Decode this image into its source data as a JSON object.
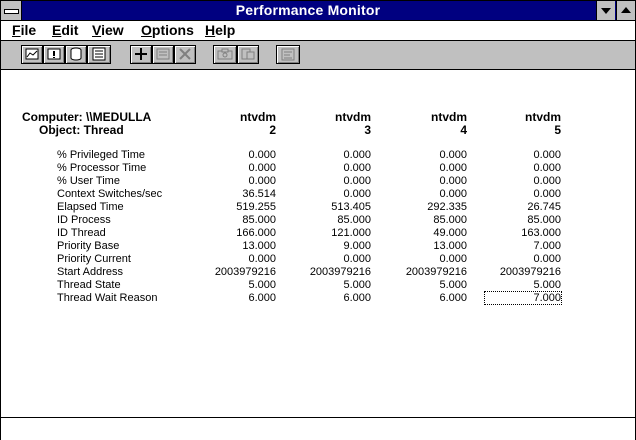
{
  "window": {
    "title": "Performance Monitor"
  },
  "menu": {
    "items": [
      {
        "key": "F",
        "rest": "ile"
      },
      {
        "key": "E",
        "rest": "dit"
      },
      {
        "key": "V",
        "rest": "iew"
      },
      {
        "key": "O",
        "rest": "ptions"
      },
      {
        "key": "H",
        "rest": "elp"
      }
    ]
  },
  "toolbar": {
    "buttons": [
      "chart-view-icon",
      "alert-view-icon",
      "log-view-icon",
      "report-view-icon",
      "add-icon",
      "edit-icon",
      "delete-icon",
      "update-now-icon",
      "bookmark-icon",
      "options-icon"
    ]
  },
  "report": {
    "computer_label": "Computer: \\\\MEDULLA",
    "object_label": "Object: Thread",
    "instances": [
      {
        "name": "ntvdm",
        "id": "2"
      },
      {
        "name": "ntvdm",
        "id": "3"
      },
      {
        "name": "ntvdm",
        "id": "4"
      },
      {
        "name": "ntvdm",
        "id": "5"
      }
    ],
    "counters": [
      {
        "name": "% Privileged Time",
        "values": [
          "0.000",
          "0.000",
          "0.000",
          "0.000"
        ]
      },
      {
        "name": "% Processor Time",
        "values": [
          "0.000",
          "0.000",
          "0.000",
          "0.000"
        ]
      },
      {
        "name": "% User Time",
        "values": [
          "0.000",
          "0.000",
          "0.000",
          "0.000"
        ]
      },
      {
        "name": "Context Switches/sec",
        "values": [
          "36.514",
          "0.000",
          "0.000",
          "0.000"
        ]
      },
      {
        "name": "Elapsed Time",
        "values": [
          "519.255",
          "513.405",
          "292.335",
          "26.745"
        ]
      },
      {
        "name": "ID Process",
        "values": [
          "85.000",
          "85.000",
          "85.000",
          "85.000"
        ]
      },
      {
        "name": "ID Thread",
        "values": [
          "166.000",
          "121.000",
          "49.000",
          "163.000"
        ]
      },
      {
        "name": "Priority Base",
        "values": [
          "13.000",
          "9.000",
          "13.000",
          "7.000"
        ]
      },
      {
        "name": "Priority Current",
        "values": [
          "0.000",
          "0.000",
          "0.000",
          "0.000"
        ]
      },
      {
        "name": "Start Address",
        "values": [
          "2003979216",
          "2003979216",
          "2003979216",
          "2003979216"
        ]
      },
      {
        "name": "Thread State",
        "values": [
          "5.000",
          "5.000",
          "5.000",
          "5.000"
        ]
      },
      {
        "name": "Thread Wait Reason",
        "values": [
          "6.000",
          "6.000",
          "6.000",
          "7.000"
        ]
      }
    ]
  }
}
